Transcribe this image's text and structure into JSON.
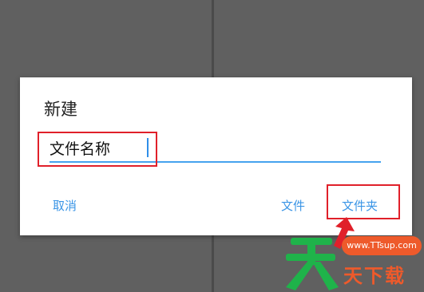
{
  "dialog": {
    "title": "新建",
    "input": {
      "value": "文件名称"
    },
    "buttons": {
      "cancel": "取消",
      "file": "文件",
      "folder": "文件夹"
    }
  },
  "watermark": {
    "url": "www.TTsup.com",
    "text": "天下载",
    "logo_char": "天"
  },
  "colors": {
    "accent": "#3a95e6",
    "underline": "#46a3ee",
    "highlight": "#e0202a",
    "watermark_green": "#1fb34a",
    "watermark_orange": "#ee5a2b",
    "backdrop": "#606060"
  },
  "icons": [
    "red-arrow-icon",
    "watermark-logo-icon"
  ]
}
